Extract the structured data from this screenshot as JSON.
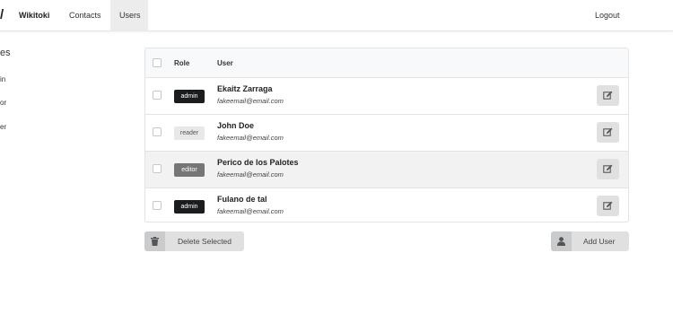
{
  "navbar": {
    "glyph": "/",
    "brand": "Wikitoki",
    "links": [
      {
        "label": "Contacts",
        "active": false
      },
      {
        "label": "Users",
        "active": true
      }
    ],
    "logout": "Logout"
  },
  "sidebar": {
    "header": "es",
    "items": [
      "in",
      "or",
      "er"
    ]
  },
  "table": {
    "headers": {
      "role": "Role",
      "user": "User"
    },
    "rows": [
      {
        "role": "admin",
        "name": "Ekaitz Zarraga",
        "email": "fakeemail@email.com",
        "highlighted": false
      },
      {
        "role": "reader",
        "name": "John Doe",
        "email": "fakeemail@email.com",
        "highlighted": false
      },
      {
        "role": "editor",
        "name": "Perico de los Palotes",
        "email": "fakeemail@email.com",
        "highlighted": true
      },
      {
        "role": "admin",
        "name": "Fulano de tal",
        "email": "fakeemail@email.com",
        "highlighted": false
      }
    ]
  },
  "actions": {
    "delete_label": "Delete Selected",
    "delete_icon": "trash-icon",
    "add_label": "Add User",
    "add_icon": "user-icon"
  },
  "colors": {
    "admin_badge": "#1b1c1d",
    "reader_badge": "#e8e8e8",
    "editor_badge": "#767676",
    "button_bg": "#e0e0e0"
  }
}
